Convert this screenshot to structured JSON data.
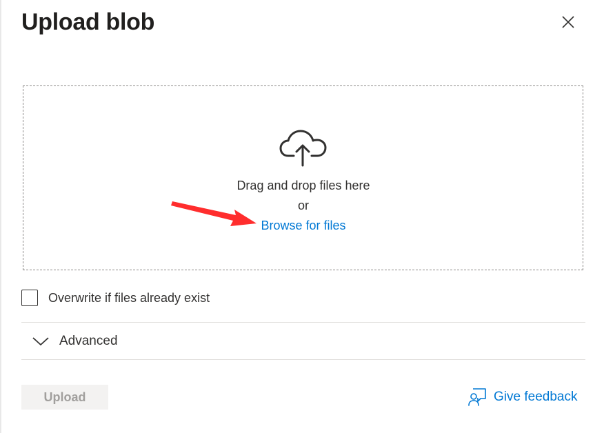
{
  "dialog": {
    "title": "Upload blob",
    "close_icon": "close-icon"
  },
  "dropzone": {
    "icon": "cloud-upload-icon",
    "drag_text": "Drag and drop files here",
    "or_text": "or",
    "browse_link": "Browse for files",
    "annotation_arrow_color": "#ff2d2d"
  },
  "options": {
    "overwrite_label": "Overwrite if files already exist",
    "overwrite_checked": false
  },
  "advanced": {
    "label": "Advanced",
    "expanded": false,
    "icon": "chevron-down-icon"
  },
  "footer": {
    "upload_label": "Upload",
    "upload_enabled": false,
    "feedback_label": "Give feedback",
    "feedback_icon": "feedback-icon"
  },
  "colors": {
    "accent": "#0078d4",
    "text": "#323130",
    "disabled_bg": "#f3f2f1",
    "disabled_text": "#a19f9d"
  }
}
